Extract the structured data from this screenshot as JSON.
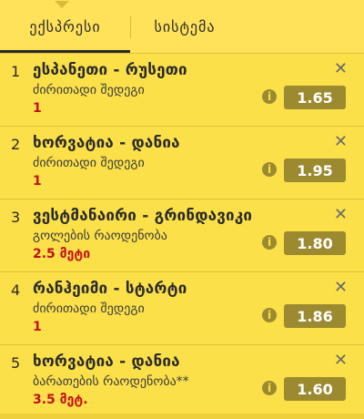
{
  "tabs": {
    "express": "ექსპრესი",
    "system": "სისტემა"
  },
  "icons": {
    "close": "close-icon",
    "info": "info-icon"
  },
  "colors": {
    "accent": "#fbe04a",
    "odds_bg": "#9b8a2f",
    "selection": "#c2111a"
  },
  "items": [
    {
      "index": "1",
      "match": "ესპანეთი - რუსეთი",
      "market": "ძირითადი შედეგი",
      "selection": "1",
      "odds": "1.65"
    },
    {
      "index": "2",
      "match": "ხორვატია - დანია",
      "market": "ძირითადი შედეგი",
      "selection": "1",
      "odds": "1.95"
    },
    {
      "index": "3",
      "match": "ვესტმანაირი - გრინდავიკი",
      "market": "გოლების რაოდენობა",
      "selection": "2.5 მეტი",
      "odds": "1.80"
    },
    {
      "index": "4",
      "match": "რანჰეიმი - სტარტი",
      "market": "ძირითადი შედეგი",
      "selection": "1",
      "odds": "1.86"
    },
    {
      "index": "5",
      "match": "ხორვატია - დანია",
      "market": "ბარათების რაოდენობა**",
      "selection": "3.5 მეტ.",
      "odds": "1.60"
    }
  ]
}
